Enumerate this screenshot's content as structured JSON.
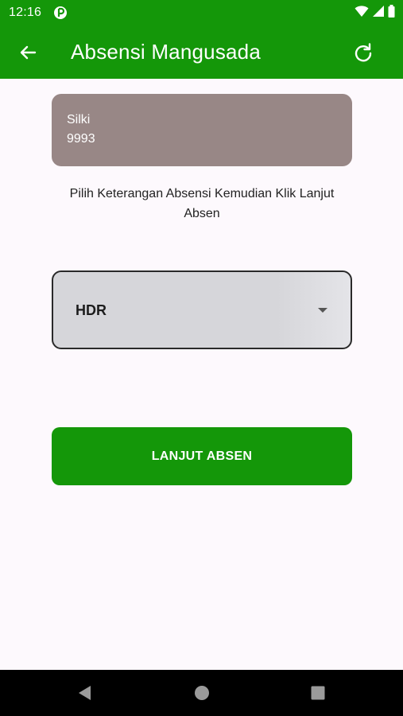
{
  "status_bar": {
    "time": "12:16"
  },
  "app_bar": {
    "title": "Absensi Mangusada"
  },
  "user_card": {
    "name": "Silki",
    "id": "9993"
  },
  "instruction": "Pilih Keterangan Absensi Kemudian Klik Lanjut Absen",
  "dropdown": {
    "selected": "HDR"
  },
  "submit_button": {
    "label": "LANJUT ABSEN"
  },
  "colors": {
    "primary": "#149709",
    "card": "#988786",
    "background": "#fdf9fd"
  }
}
